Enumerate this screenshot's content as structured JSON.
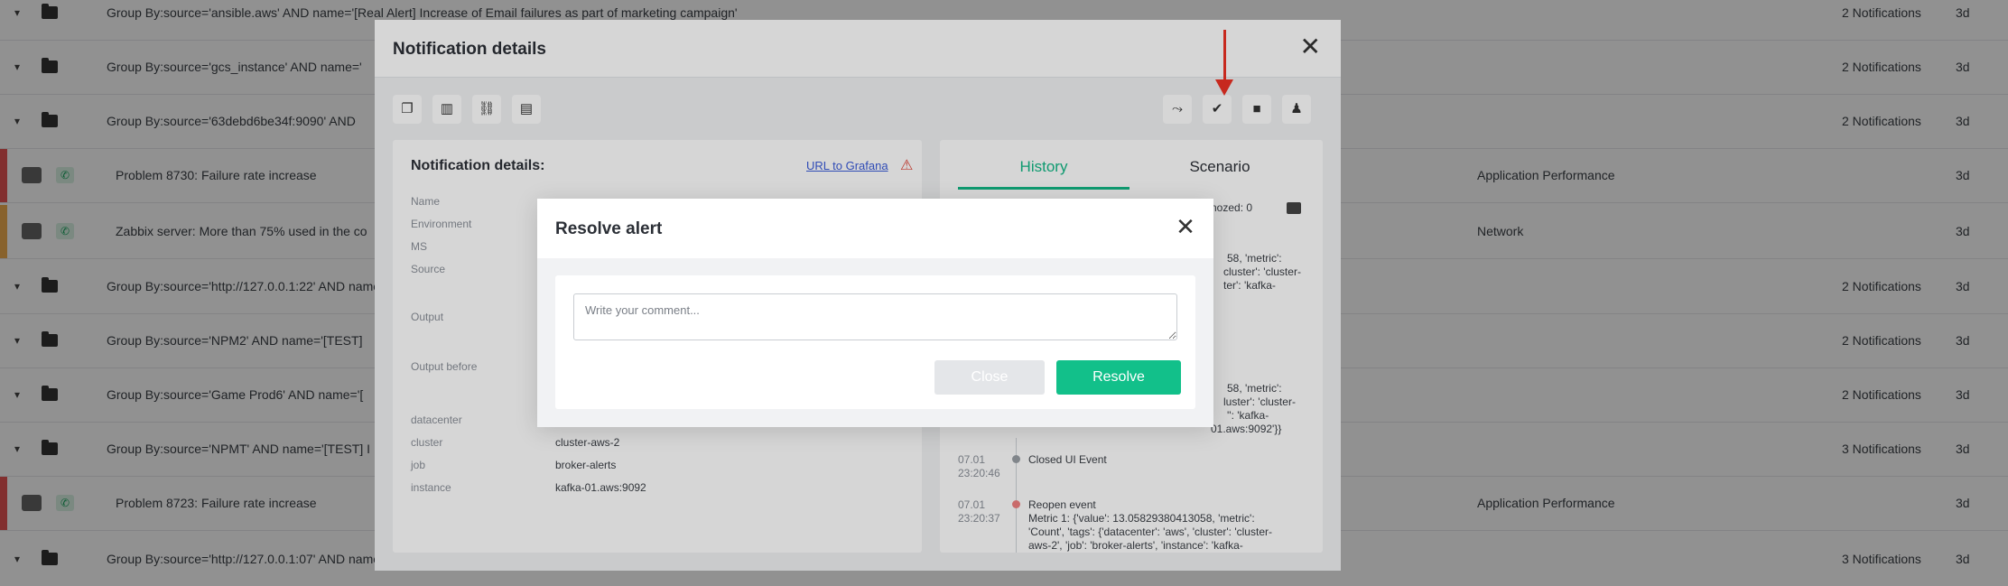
{
  "background": {
    "rows": [
      {
        "type": "group",
        "title": "Group By:source='ansible.aws' AND name='[Real Alert] Increase of Email failures as part of marketing campaign'",
        "count": "2 Notifications",
        "action": "3d"
      },
      {
        "type": "group",
        "title": "Group By:source='gcs_instance' AND name='",
        "count": "2 Notifications",
        "action": "3d"
      },
      {
        "type": "group",
        "title": "Group By:source='63debd6be34f:9090' AND",
        "count": "2 Notifications",
        "action": "3d"
      },
      {
        "type": "problem",
        "title": "Problem 8730: Failure rate increase",
        "category": "Application Performance",
        "action": "3d",
        "severity_color": "#e55353"
      },
      {
        "type": "problem",
        "title": "Zabbix server: More than 75% used in the co",
        "category": "Network",
        "action": "3d",
        "severity_color": "#f0ad4e"
      },
      {
        "type": "group",
        "title": "Group By:source='http://127.0.0.1:22' AND name=",
        "count": "2 Notifications",
        "action": "3d"
      },
      {
        "type": "group",
        "title": "Group By:source='NPM2' AND name='[TEST]",
        "count": "2 Notifications",
        "action": "3d"
      },
      {
        "type": "group",
        "title": "Group By:source='Game Prod6' AND name='[",
        "count": "2 Notifications",
        "action": "3d"
      },
      {
        "type": "group",
        "title": "Group By:source='NPMT' AND name='[TEST] I",
        "count": "3 Notifications",
        "action": "3d"
      },
      {
        "type": "problem",
        "title": "Problem 8723: Failure rate increase",
        "category": "Application Performance",
        "action": "3d",
        "severity_color": "#e55353"
      },
      {
        "type": "group",
        "title": "Group By:source='http://127.0.0.1:07' AND name",
        "count": "3 Notifications",
        "action": "3d"
      }
    ]
  },
  "notification_modal": {
    "title": "Notification details",
    "section_title": "Notification details:",
    "grafana_link": "URL to Grafana",
    "fields": [
      {
        "label": "Name",
        "value": ""
      },
      {
        "label": "Environment",
        "value": ""
      },
      {
        "label": "MS",
        "value": ""
      },
      {
        "label": "Source",
        "value": ""
      },
      {
        "label": "Output",
        "value": ""
      },
      {
        "label": "Output before",
        "value": ""
      },
      {
        "label": "datacenter",
        "value": ""
      },
      {
        "label": "cluster",
        "value": "cluster-aws-2"
      },
      {
        "label": "job",
        "value": "broker-alerts"
      },
      {
        "label": "instance",
        "value": "kafka-01.aws:9092"
      }
    ],
    "tabs": [
      "History",
      "Scenario"
    ],
    "history_fragments": {
      "snoozed": "nozed: 0",
      "frag1": "58, 'metric':",
      "frag2": "cluster': 'cluster-",
      "frag3": "ter': 'kafka-",
      "frag4": "58, 'metric':",
      "frag5": "luster': 'cluster-",
      "frag6": "'': 'kafka-",
      "frag7": "01.aws:9092'}}"
    },
    "timeline": [
      {
        "time": "07.01\n23:20:46",
        "text": "Closed UI Event",
        "dot_color": "#9aa0a6"
      },
      {
        "time": "07.01\n23:20:37",
        "text": "Reopen event\nMetric 1: {'value': 13.05829380413058, 'metric':\n'Count', 'tags': {'datacenter': 'aws', 'cluster': 'cluster-\naws-2', 'job': 'broker-alerts', 'instance': 'kafka-",
        "dot_color": "#f08080"
      }
    ]
  },
  "resolve_modal": {
    "title": "Resolve alert",
    "comment_placeholder": "Write your comment...",
    "close_label": "Close",
    "resolve_label": "Resolve"
  },
  "colors": {
    "accent": "#12c08a",
    "arrow": "#ee3124",
    "link": "#3a5bd9"
  }
}
